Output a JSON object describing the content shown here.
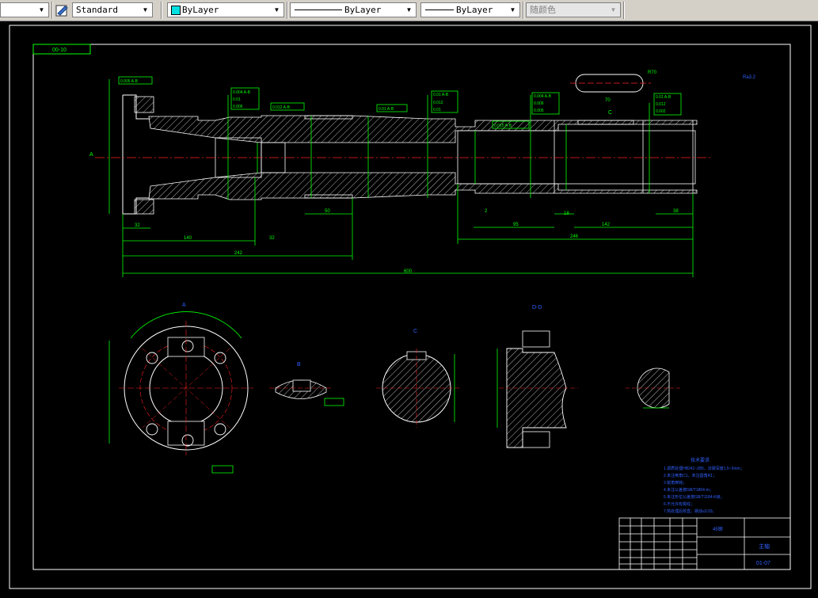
{
  "toolbar": {
    "textstyle_value": "Standard",
    "layer_value": "ByLayer",
    "linetype_value": "ByLayer",
    "lineweight_value": "ByLayer",
    "plotstyle_value": "随颜色"
  },
  "drawing": {
    "frame_tag": "00-10",
    "roughness_symbol": "Ra3.2",
    "slot_radius": "R70",
    "slot_length": "70",
    "section_a": "A",
    "section_b": "B",
    "section_c": "C",
    "section_d": "D-D",
    "dims": {
      "d32": "32",
      "d140": "140",
      "d242": "242",
      "d600": "600",
      "d50": "50",
      "d38": "38",
      "d142": "142",
      "d246": "246",
      "d95": "95",
      "d18": "18",
      "d2": "2"
    },
    "tech_title": "技术要求",
    "tech_lines": [
      "1.调质处理HB241~285，淬硬深度1.5~2mm；",
      "2.未注倒角C1，未注圆角R1；",
      "3.锐角倒钝；",
      "4.未注公差按GB/T1804-m；",
      "5.未注形位公差按GB/T1184-K级；",
      "6.不允许有裂纹；",
      "7.热处理后校直，跳动≤0.03。"
    ],
    "title_block": {
      "part_name": "主轴",
      "material": "45钢",
      "drawing_no": "01-07"
    }
  }
}
